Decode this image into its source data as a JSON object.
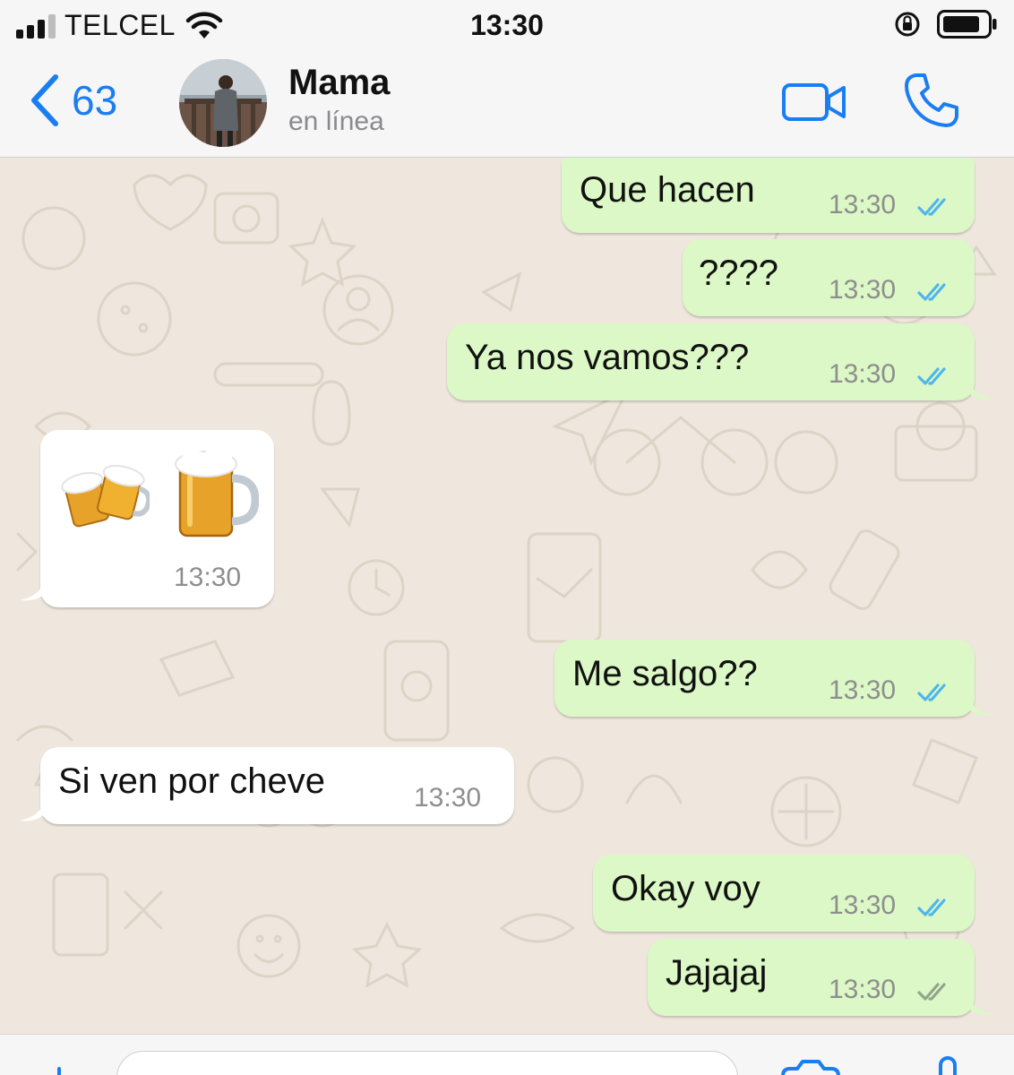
{
  "status_bar": {
    "carrier": "TELCEL",
    "time": "13:30",
    "signal_bars_filled": 3,
    "signal_bars_total": 4
  },
  "header": {
    "back_count": "63",
    "contact_name": "Mama",
    "contact_status": "en línea",
    "icons": [
      "chevron-left-icon",
      "video-camera-icon",
      "phone-icon"
    ]
  },
  "messages": [
    {
      "id": "m1",
      "direction": "outgoing",
      "text": "Que hacen",
      "time": "13:30",
      "status": "read"
    },
    {
      "id": "m2",
      "direction": "outgoing",
      "text": "????",
      "time": "13:30",
      "status": "read"
    },
    {
      "id": "m3",
      "direction": "outgoing",
      "text": "Ya nos vamos???",
      "time": "13:30",
      "status": "read"
    },
    {
      "id": "m4",
      "direction": "incoming",
      "text": "🍻 🍺",
      "time": "13:30",
      "emoji_only": true
    },
    {
      "id": "m5",
      "direction": "outgoing",
      "text": "Me salgo??",
      "time": "13:30",
      "status": "read"
    },
    {
      "id": "m6",
      "direction": "incoming",
      "text": "Si ven por cheve",
      "time": "13:30"
    },
    {
      "id": "m7",
      "direction": "outgoing",
      "text": "Okay voy",
      "time": "13:30",
      "status": "read"
    },
    {
      "id": "m8",
      "direction": "outgoing",
      "text": "Jajajaj",
      "time": "13:30",
      "status": "delivered"
    }
  ],
  "colors": {
    "accent": "#1a7ef2",
    "outgoing_bubble": "#dcf8c6",
    "incoming_bubble": "#ffffff",
    "chat_background": "#efe7dd",
    "read_ticks": "#4fb6ec",
    "delivered_ticks": "#92a58c"
  }
}
